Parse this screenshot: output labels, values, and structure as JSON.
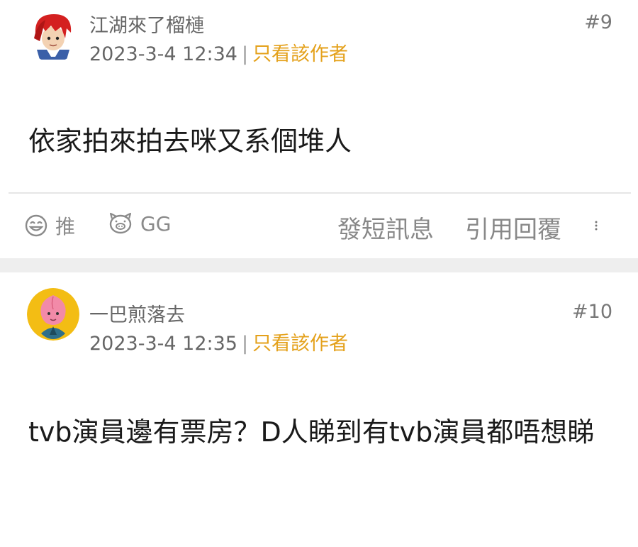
{
  "posts": [
    {
      "username": "江湖來了榴槤",
      "date": "2023-3-4 12:34",
      "separator": "|",
      "author_only": "只看該作者",
      "floor": "#9",
      "content": "依家拍來拍去咪又系個堆人",
      "actions": {
        "like": "推",
        "gg": "GG",
        "message": "發短訊息",
        "quote": "引用回覆"
      },
      "avatar_icon": "red-hair-anime-avatar"
    },
    {
      "username": "一巴煎落去",
      "date": "2023-3-4 12:35",
      "separator": "|",
      "author_only": "只看該作者",
      "floor": "#10",
      "content": "tvb演員邊有票房？D人睇到有tvb演員都唔想睇",
      "avatar_icon": "pink-peach-avatar"
    }
  ],
  "colors": {
    "accent": "#e4a11b",
    "text": "#1a1a1a",
    "muted": "#666666",
    "separator_band": "#eeeeee"
  }
}
